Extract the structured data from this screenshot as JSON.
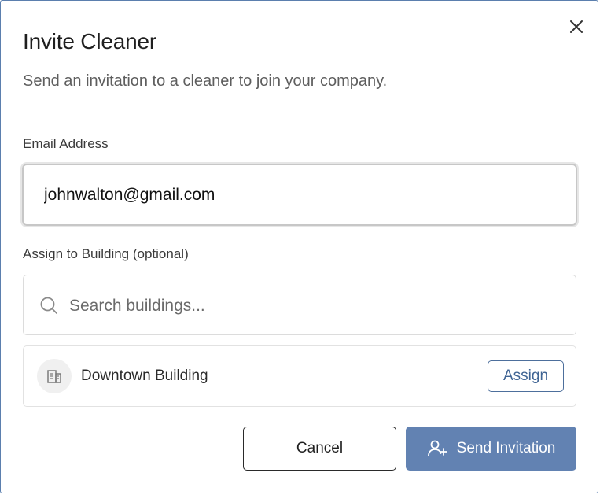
{
  "dialog": {
    "title": "Invite Cleaner",
    "subtitle": "Send an invitation to a cleaner to join your company."
  },
  "email": {
    "label": "Email Address",
    "value": "johnwalton@gmail.com"
  },
  "building": {
    "label": "Assign to Building (optional)",
    "search_placeholder": "Search buildings...",
    "items": [
      {
        "name": "Downtown Building",
        "action_label": "Assign",
        "icon": "building-icon"
      }
    ]
  },
  "actions": {
    "cancel_label": "Cancel",
    "send_label": "Send Invitation",
    "send_icon": "user-plus-icon"
  },
  "icons": {
    "close": "close-icon",
    "search": "search-icon"
  },
  "colors": {
    "primary": "#6282b2",
    "accent_text": "#3f6494",
    "dialog_border": "#5b7fae"
  }
}
